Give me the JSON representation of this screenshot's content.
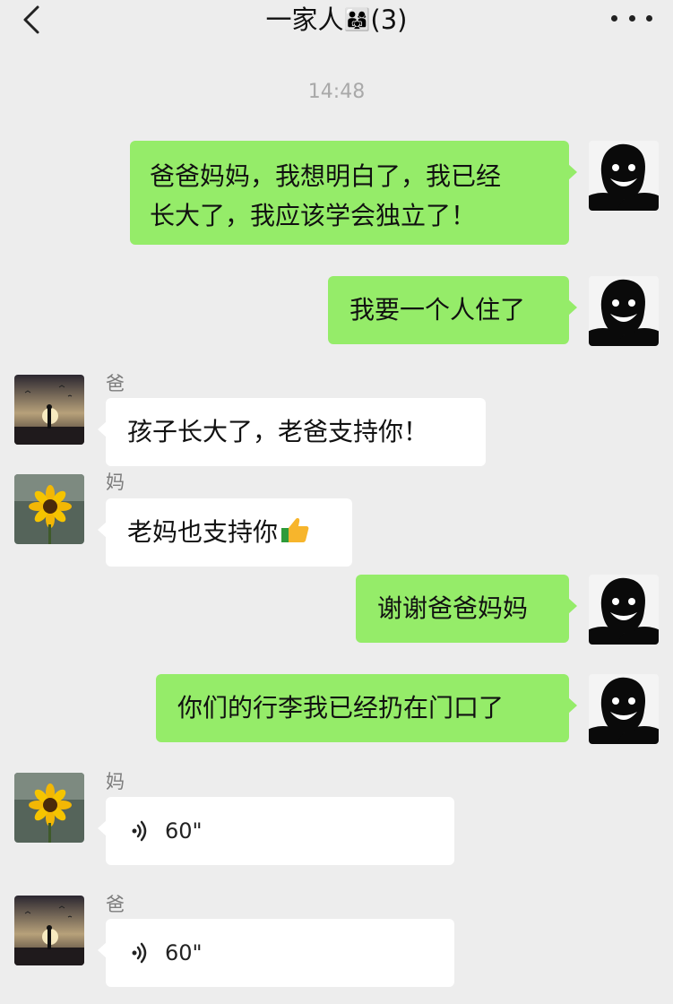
{
  "header": {
    "title": "一家人",
    "title_emoji": "👨‍👩‍👧",
    "member_count": "(3)",
    "back_icon": "chevron-left-icon",
    "more_icon": "more-dots-icon"
  },
  "timestamp": "14:48",
  "colors": {
    "background": "#ededed",
    "my_bubble": "#95ec69",
    "other_bubble": "#ffffff"
  },
  "messages": [
    {
      "from": "me",
      "text_lines": [
        "爸爸妈妈，我想明白了，我已经",
        "长大了，我应该学会独立了！"
      ]
    },
    {
      "from": "me",
      "text": "我要一个人住了"
    },
    {
      "from": "dad",
      "sender": "爸",
      "text": "孩子长大了，老爸支持你！"
    },
    {
      "from": "mom",
      "sender": "妈",
      "text": "老妈也支持你",
      "emoji": "👍"
    },
    {
      "from": "me",
      "text": "谢谢爸爸妈妈"
    },
    {
      "from": "me",
      "text": "你们的行李我已经扔在门口了"
    },
    {
      "from": "mom",
      "sender": "妈",
      "voice_duration": "60\""
    },
    {
      "from": "dad",
      "sender": "爸",
      "voice_duration": "60\""
    }
  ]
}
